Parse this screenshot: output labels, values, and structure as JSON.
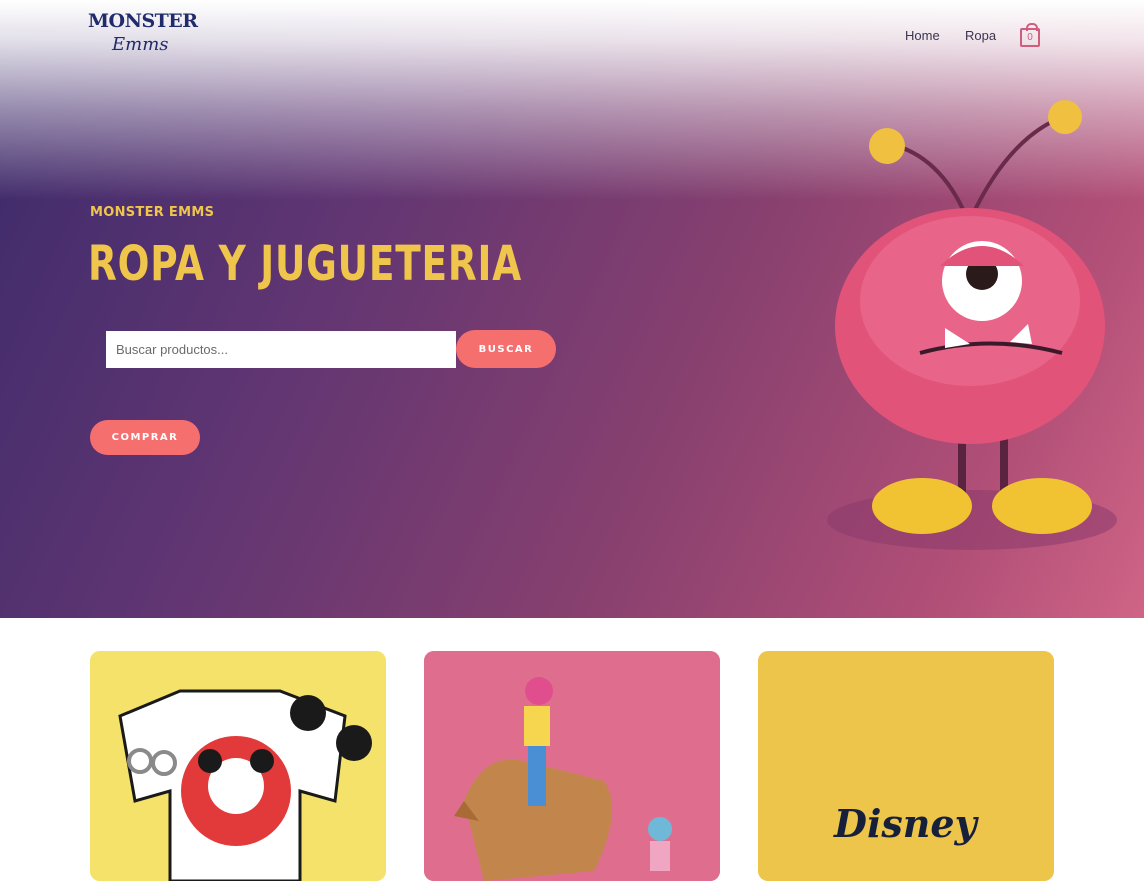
{
  "header": {
    "logo_top": "MONSTER",
    "logo_bottom": "Emms",
    "nav": [
      {
        "label": "Home"
      },
      {
        "label": "Ropa"
      }
    ],
    "cart_count": "0"
  },
  "hero": {
    "eyebrow": "MONSTER EMMS",
    "headline": "ROPA Y JUGUETERIA",
    "search": {
      "placeholder": "Buscar productos...",
      "value": "",
      "button": "BUSCAR"
    },
    "cta": "COMPRAR",
    "illustration": "pink-monster-illustration"
  },
  "cards": [
    {
      "image": "mickey-mouse-club-outfit-photo",
      "background": "#f4e26a"
    },
    {
      "image": "barbie-horse-toy-photo",
      "background": "#df6e8e"
    },
    {
      "image": "disney-logo",
      "text": "Disney",
      "background": "#ecc54a"
    }
  ],
  "colors": {
    "accent": "#f56f6f",
    "headline": "#efc64b",
    "nav_text": "#3a3550",
    "cart": "#d05d7c"
  }
}
